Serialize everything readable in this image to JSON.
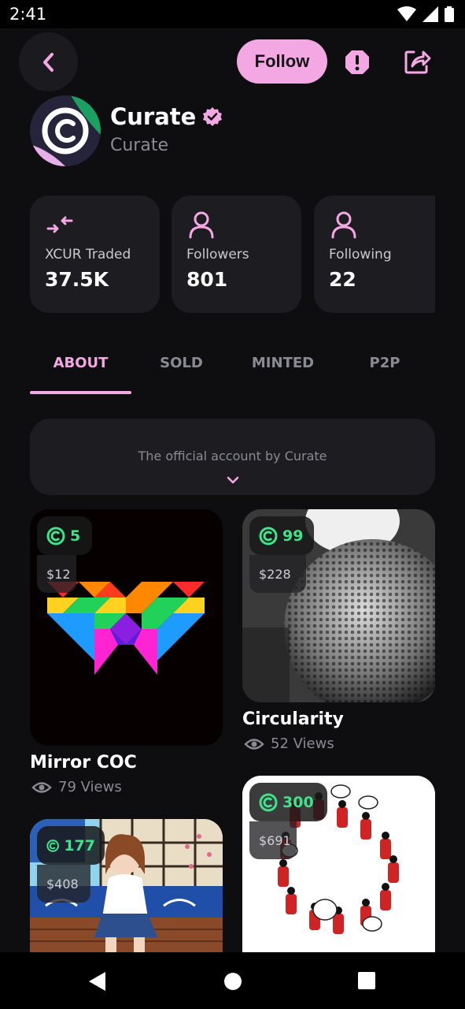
{
  "status": {
    "time": "2:41"
  },
  "header": {
    "follow_label": "Follow"
  },
  "profile": {
    "name": "Curate",
    "handle": "Curate"
  },
  "stats": [
    {
      "label": "XCUR Traded",
      "value": "37.5K",
      "icon": "swap-icon"
    },
    {
      "label": "Followers",
      "value": "801",
      "icon": "user-icon"
    },
    {
      "label": "Following",
      "value": "22",
      "icon": "user-icon"
    }
  ],
  "tabs": [
    {
      "label": "ABOUT",
      "active": true
    },
    {
      "label": "SOLD",
      "active": false
    },
    {
      "label": "MINTED",
      "active": false
    },
    {
      "label": "P2P",
      "active": false
    }
  ],
  "about": {
    "text": "The official account by Curate"
  },
  "cards": [
    {
      "title": "Mirror COC",
      "count": "5",
      "price": "$12",
      "views": "79 Views"
    },
    {
      "title": "Circularity",
      "count": "99",
      "price": "$228",
      "views": "52 Views"
    },
    {
      "title": "",
      "count": "177",
      "price": "$408",
      "views": ""
    },
    {
      "title": "",
      "count": "300",
      "price": "$691",
      "views": ""
    }
  ],
  "colors": {
    "accent": "#f3a8e3",
    "badge_green": "#3ee38a",
    "background": "#0e0e10",
    "card": "#1c1c21"
  }
}
